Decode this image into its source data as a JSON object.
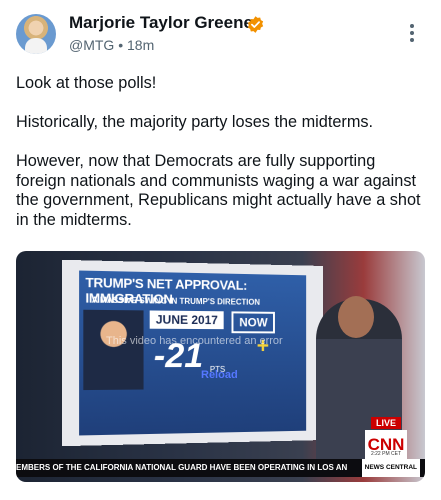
{
  "author": {
    "name": "Marjorie Taylor Greene",
    "handle": "@MTG",
    "separator": "•",
    "time": "18m"
  },
  "post": {
    "paragraphs": [
      "Look at those polls!",
      "Historically, the majority party loses the midterms.",
      "However, now that Democrats are fully supporting foreign nationals and communists waging a war against the government, Republicans might actually have a shot in the midterms."
    ]
  },
  "media": {
    "headline": "TRUMP'S NET APPROVAL: IMMIGRATION",
    "subhead": "A MASSIVE SWING IN TRUMP'S DIRECTION",
    "date_label": "JUNE 2017",
    "now_label": "NOW",
    "value_label": "-21",
    "pts_label": "PTS",
    "gain_label": "+",
    "overlay_message": "This video has encountered an error",
    "reload_label": "Reload",
    "live_label": "LIVE",
    "network": "CNN",
    "time_label": "2:22 PM CET",
    "ticker": "EMBERS OF THE CALIFORNIA NATIONAL GUARD HAVE BEEN OPERATING IN LOS AN",
    "ticker_tag": "NEWS CENTRAL"
  },
  "colors": {
    "verified": "#f29100",
    "text": "#0f1419",
    "muted": "#536471"
  }
}
